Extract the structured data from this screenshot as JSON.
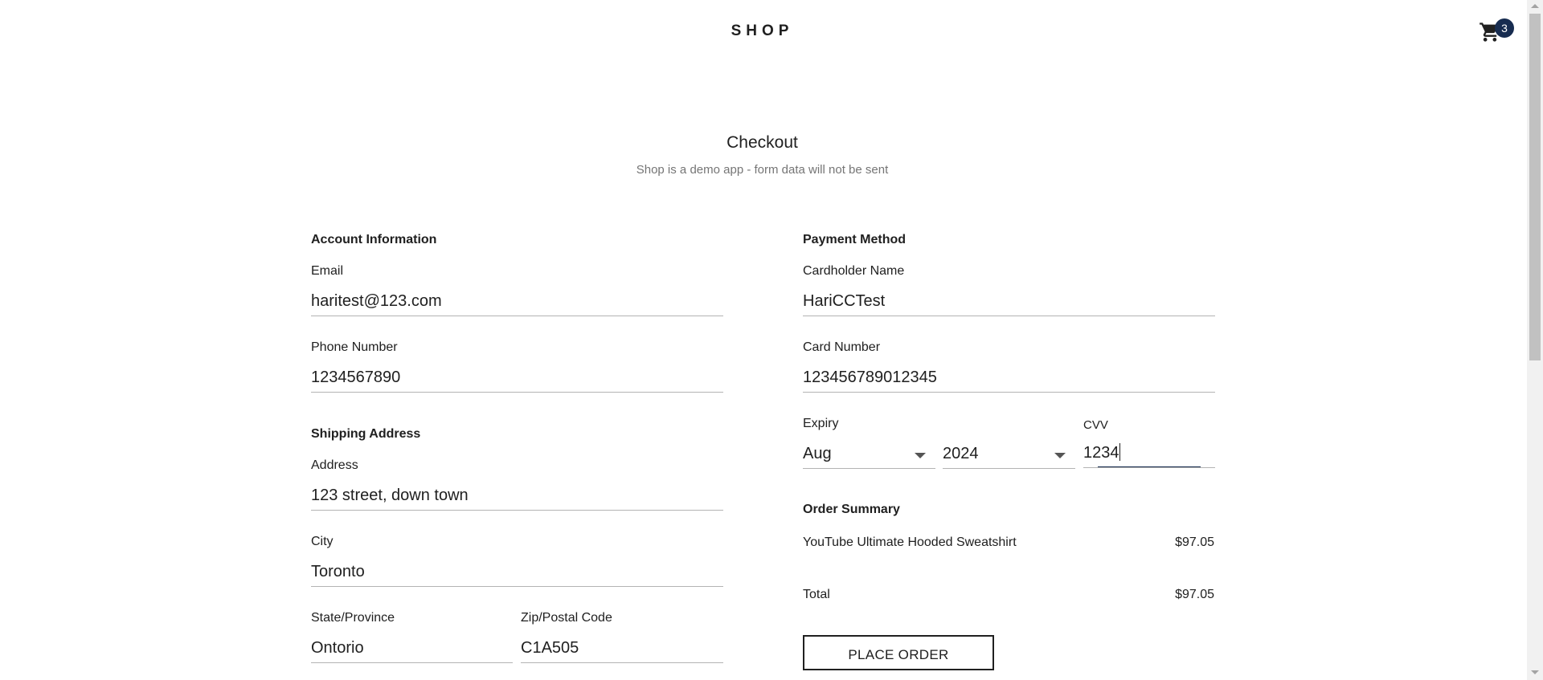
{
  "header": {
    "brand": "SHOP",
    "cart_count": "3",
    "cart_icon": "shopping-cart-icon"
  },
  "page": {
    "title": "Checkout",
    "subtitle": "Shop is a demo app - form data will not be sent"
  },
  "account": {
    "section_title": "Account Information",
    "email_label": "Email",
    "email_value": "haritest@123.com",
    "phone_label": "Phone Number",
    "phone_value": "1234567890"
  },
  "shipping": {
    "section_title": "Shipping Address",
    "address_label": "Address",
    "address_value": "123 street, down town",
    "city_label": "City",
    "city_value": "Toronto",
    "state_label": "State/Province",
    "state_value": "Ontorio",
    "zip_label": "Zip/Postal Code",
    "zip_value": "C1A505"
  },
  "payment": {
    "section_title": "Payment Method",
    "name_label": "Cardholder Name",
    "name_value": "HariCCTest",
    "card_label": "Card Number",
    "card_value": "123456789012345",
    "expiry_label": "Expiry",
    "expiry_month": "Aug",
    "expiry_year": "2024",
    "cvv_label": "CVV",
    "cvv_value": "1234"
  },
  "summary": {
    "section_title": "Order Summary",
    "items": [
      {
        "name": "YouTube Ultimate Hooded Sweatshirt",
        "price": "$97.05"
      }
    ],
    "total_label": "Total",
    "total_value": "$97.05",
    "place_order_label": "PLACE ORDER"
  },
  "colors": {
    "accent": "#172c50",
    "text": "#202020",
    "muted": "#757575",
    "underline": "#b3b3b3"
  }
}
